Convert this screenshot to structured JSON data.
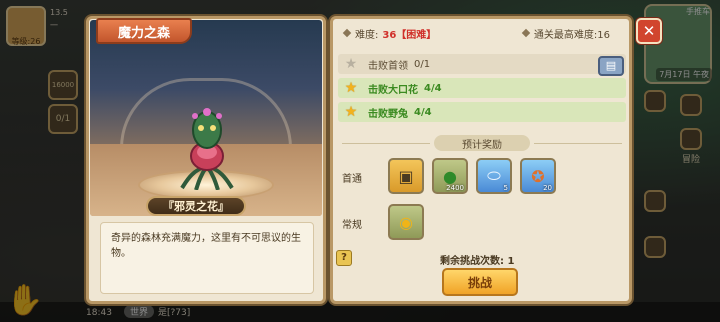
{
  "hud": {
    "level": "等级:26",
    "res1": "13.5",
    "res2": "一",
    "btn_a_label": "16000",
    "btn_b_label": "0/1",
    "minimap_tag": "手推车",
    "minimap_date": "7月17日 午夜",
    "side_label": "冒险",
    "bottom_time": "18:43",
    "bottom_chat_tag": "世界",
    "bottom_chat_text": "是[?73]"
  },
  "left_panel": {
    "title": "魔力之森",
    "boss_name": "『邪灵之花』",
    "description": "奇异的森林充满魔力，这里有不可思议的生物。"
  },
  "right_panel": {
    "difficulty_label": "难度:",
    "difficulty_value": "36【困难】",
    "max_cleared_label": "通关最高难度:16",
    "objectives": [
      {
        "text": "击败首领",
        "count": "0/1",
        "done": false
      },
      {
        "text": "击败大口花",
        "count": "4/4",
        "done": true
      },
      {
        "text": "击败野兔",
        "count": "4/4",
        "done": true
      }
    ],
    "reward_title": "预计奖励",
    "first_clear_label": "首通",
    "regular_label": "常规",
    "first_clear_items": [
      {
        "icon": "chest-icon",
        "qty": "",
        "style": "gold"
      },
      {
        "icon": "green-orb-icon",
        "qty": "2400",
        "style": "olive"
      },
      {
        "icon": "capsule-icon",
        "qty": "5",
        "style": "blue"
      },
      {
        "icon": "medal-icon",
        "qty": "20",
        "style": "blue"
      }
    ],
    "regular_items": [
      {
        "icon": "gold-coin-icon",
        "qty": "",
        "style": "olive"
      }
    ],
    "remaining_attempts": "剩余挑战次数: 1",
    "challenge_button": "挑战",
    "help_label": "?",
    "close_label": "✕"
  },
  "colors": {
    "panel_bg": "#efe6d3",
    "accent_red": "#d0302a",
    "objective_done_green": "#3a8a20",
    "challenge_button": "#f0a326"
  }
}
